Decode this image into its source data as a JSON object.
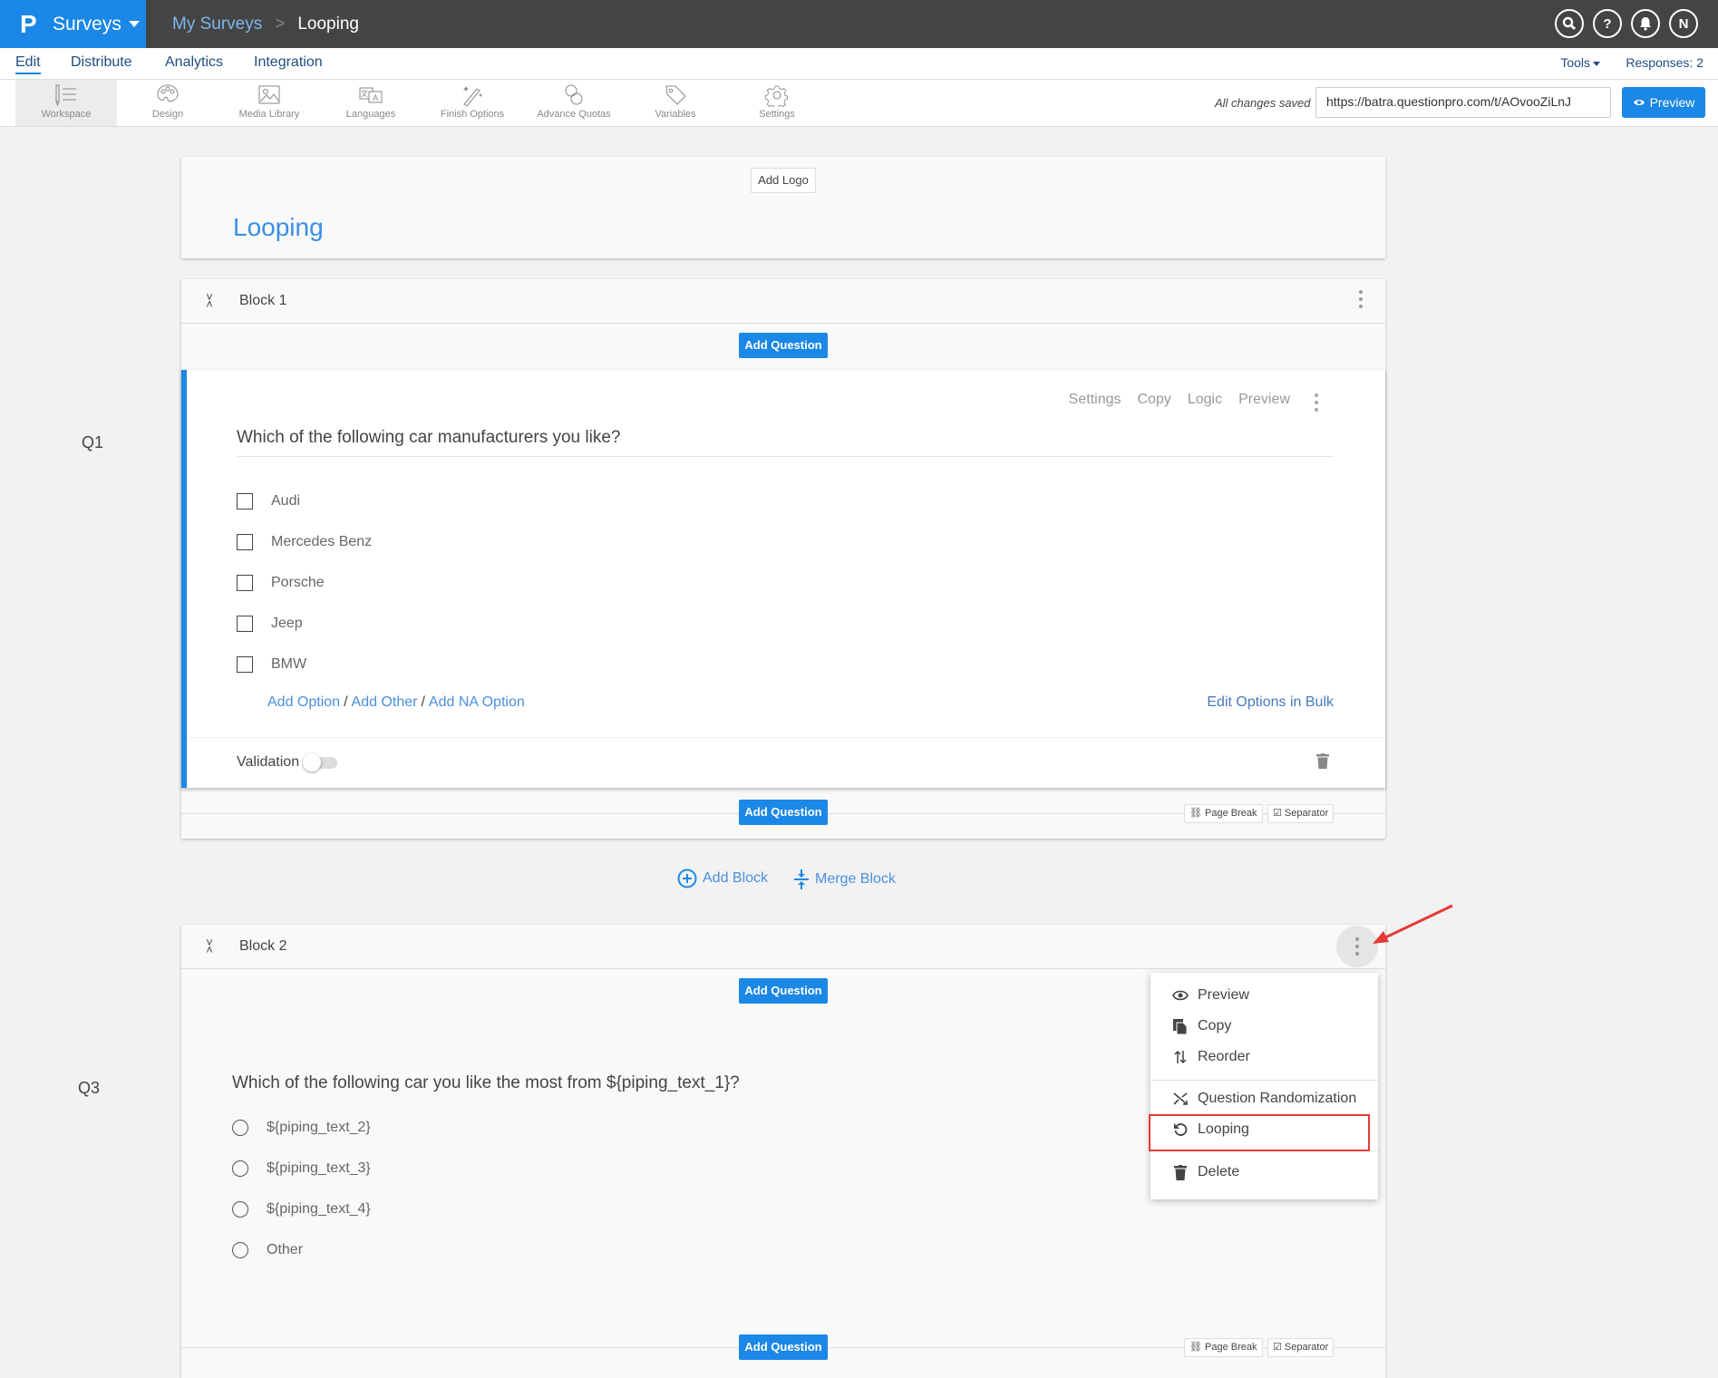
{
  "app": {
    "logo": "P",
    "name": "Surveys"
  },
  "breadcrumb": {
    "parent": "My Surveys",
    "separator": ">",
    "current": "Looping"
  },
  "top_icons": [
    {
      "name": "search-icon",
      "glyph": "🔍"
    },
    {
      "name": "help-icon",
      "glyph": "?"
    },
    {
      "name": "bell-icon",
      "glyph": "🔔"
    },
    {
      "name": "user-avatar",
      "glyph": "N"
    }
  ],
  "tabs": [
    {
      "label": "Edit",
      "active": true
    },
    {
      "label": "Distribute"
    },
    {
      "label": "Analytics"
    },
    {
      "label": "Integration"
    }
  ],
  "tools_label": "Tools",
  "responses_label": "Responses: 2",
  "toolbar": [
    {
      "label": "Workspace",
      "icon": "workspace-icon",
      "active": true
    },
    {
      "label": "Design",
      "icon": "palette-icon"
    },
    {
      "label": "Media Library",
      "icon": "image-icon"
    },
    {
      "label": "Languages",
      "icon": "translate-icon"
    },
    {
      "label": "Finish Options",
      "icon": "magic-wand-icon"
    },
    {
      "label": "Advance Quotas",
      "icon": "chain-icon"
    },
    {
      "label": "Variables",
      "icon": "tag-icon"
    },
    {
      "label": "Settings",
      "icon": "gear-icon"
    }
  ],
  "status": "All changes saved",
  "survey_url": "https://batra.questionpro.com/t/AOvooZiLnJ",
  "preview_label": "Preview",
  "survey": {
    "add_logo": "Add Logo",
    "title": "Looping"
  },
  "block1": {
    "name": "Block 1",
    "add_question": "Add Question",
    "question": {
      "number": "Q1",
      "text": "Which of the following car manufacturers you like?",
      "actions": [
        "Settings",
        "Copy",
        "Logic",
        "Preview"
      ],
      "options": [
        "Audi",
        "Mercedes Benz",
        "Porsche",
        "Jeep",
        "BMW"
      ],
      "add_option": "Add Option",
      "add_other": "Add Other",
      "add_na": "Add NA Option",
      "slash": "/",
      "edit_bulk": "Edit Options in Bulk",
      "validation": "Validation",
      "validation_on": false
    },
    "footer": {
      "add_question": "Add Question",
      "page_break": "Page Break",
      "separator": "Separator"
    }
  },
  "add_block": "Add Block",
  "merge_block": "Merge Block",
  "block2": {
    "name": "Block 2",
    "add_question": "Add Question",
    "question": {
      "number": "Q3",
      "text": "Which of the following car you like the most from ${piping_text_1}?",
      "options": [
        "${piping_text_2}",
        "${piping_text_3}",
        "${piping_text_4}",
        "Other"
      ]
    },
    "footer": {
      "add_question": "Add Question",
      "page_break": "Page Break",
      "separator": "Separator"
    }
  },
  "block_menu": [
    {
      "label": "Preview",
      "icon": "eye-icon"
    },
    {
      "label": "Copy",
      "icon": "copy-icon"
    },
    {
      "label": "Reorder",
      "icon": "reorder-icon"
    },
    {
      "label": "Question Randomization",
      "icon": "shuffle-icon"
    },
    {
      "label": "Looping",
      "icon": "loop-icon",
      "highlighted": true
    },
    {
      "label": "Delete",
      "icon": "trash-icon"
    }
  ],
  "colors": {
    "brand": "#1b87e6",
    "topbar": "#444444",
    "highlight": "#e53935"
  }
}
